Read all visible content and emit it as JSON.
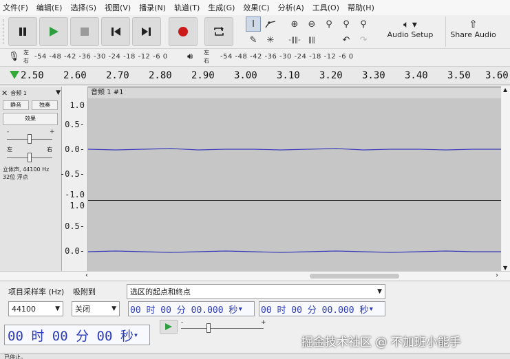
{
  "menu": [
    "文件(F)",
    "编辑(E)",
    "选择(S)",
    "视图(V)",
    "播录(N)",
    "轨道(T)",
    "生成(G)",
    "效果(C)",
    "分析(A)",
    "工具(O)",
    "帮助(H)"
  ],
  "toolbar": {
    "audio_setup": "Audio Setup",
    "share_audio": "Share Audio"
  },
  "meters": {
    "rec_lr_top": "左",
    "rec_lr_bot": "右",
    "rec_scale": "-54 -48 -42 -36 -30 -24 -18 -12 -6 0",
    "play_lr_top": "左",
    "play_lr_bot": "右",
    "play_scale": "-54 -48 -42 -36 -30 -24 -18 -12 -6 0"
  },
  "timeline": {
    "ticks": [
      "2.50",
      "2.60",
      "2.70",
      "2.80",
      "2.90",
      "3.00",
      "3.10",
      "3.20",
      "3.30",
      "3.40",
      "3.50",
      "3.60"
    ]
  },
  "track": {
    "name": "音频 1",
    "clip_title": "音频 1 #1",
    "mute": "静音",
    "solo": "独奏",
    "effects": "效果",
    "pan_left": "左",
    "pan_right": "右",
    "gain_minus": "-",
    "gain_plus": "+",
    "info1": "立体声, 44100 Hz",
    "info2": "32位 浮点",
    "scale_top": [
      "1.0",
      "0.5-",
      "0.0-",
      "-0.5-",
      "-1.0"
    ],
    "scale_bottom": [
      "1.0",
      "0.5-",
      "0.0-"
    ]
  },
  "bottom": {
    "rate_label": "项目采样率 (Hz)",
    "snap_label": "吸附到",
    "sel_label": "选区的起点和終点",
    "rate_value": "44100",
    "snap_value": "关闭",
    "sel_start": "00 时 00 分 00.000 秒",
    "sel_end": "00 时 00 分 00.000 秒",
    "time_display": "00 时 00 分 00 秒",
    "speed_minus": "-",
    "speed_plus": "+"
  },
  "status": {
    "text": "已停止。"
  },
  "watermark": "掘金技术社区 @ 不加班小能手"
}
